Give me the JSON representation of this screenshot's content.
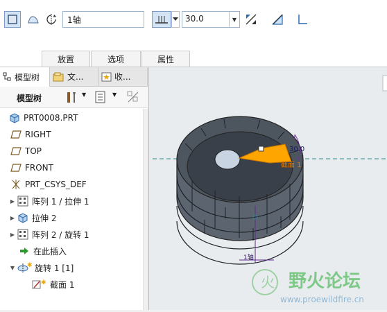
{
  "dashboard": {
    "axis_value": "1轴",
    "angle_value": "30.0",
    "tabs": [
      "放置",
      "选项",
      "属性"
    ]
  },
  "panel_tabs": [
    "模型树",
    "文...",
    "收..."
  ],
  "tree_toolbar": {
    "label": "模型树"
  },
  "tree": [
    {
      "label": "PRT0008.PRT",
      "icon": "part-icon",
      "expander": ""
    },
    {
      "label": "RIGHT",
      "icon": "datum-plane-icon",
      "expander": ""
    },
    {
      "label": "TOP",
      "icon": "datum-plane-icon",
      "expander": ""
    },
    {
      "label": "FRONT",
      "icon": "datum-plane-icon",
      "expander": ""
    },
    {
      "label": "PRT_CSYS_DEF",
      "icon": "csys-icon",
      "expander": ""
    },
    {
      "label": "阵列 1 / 拉伸 1",
      "icon": "pattern-icon",
      "expander": "▶"
    },
    {
      "label": "拉伸 2",
      "icon": "extrude-icon",
      "expander": "▶"
    },
    {
      "label": "阵列 2 / 旋转 1",
      "icon": "pattern-icon",
      "expander": "▶"
    },
    {
      "label": "在此插入",
      "icon": "insert-arrow-icon",
      "expander": ""
    },
    {
      "label": "旋转 1 [1]",
      "icon": "revolve-icon",
      "expander": "▼"
    },
    {
      "label": "截面 1",
      "icon": "sketch-icon",
      "expander": ""
    }
  ],
  "viewport": {
    "dimension": "30.0",
    "section_label": "截面 1",
    "axis_label": "1轴",
    "watermark_title": "野火论坛",
    "watermark_url": "www.proewildfire.cn"
  }
}
